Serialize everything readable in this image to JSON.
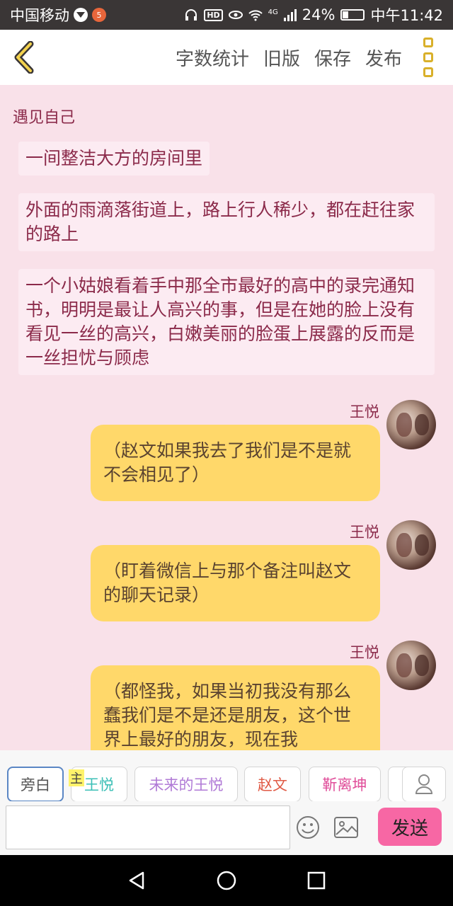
{
  "status_bar": {
    "carrier": "中国移动",
    "badge": "5",
    "network": "4G",
    "battery": "24%",
    "time": "中午11:42"
  },
  "topbar": {
    "actions": [
      "字数统计",
      "旧版",
      "保存",
      "发布"
    ]
  },
  "story": {
    "title": "遇见自己",
    "narrations": [
      "一间整洁大方的房间里",
      "外面的雨滴落街道上，路上行人稀少，都在赶往家的路上",
      "一个小姑娘看着手中那全市最好的高中的录完通知书，明明是最让人高兴的事，但是在她的脸上没有看见一丝的高兴，白嫩美丽的脸蛋上展露的反而是一丝担忧与顾虑"
    ],
    "messages": [
      {
        "speaker": "王悦",
        "text": "（赵文如果我去了我们是不是就不会相见了）"
      },
      {
        "speaker": "王悦",
        "text": "（盯着微信上与那个备注叫赵文的聊天记录）"
      },
      {
        "speaker": "王悦",
        "text": "（都怪我，如果当初我没有那么蠢我们是不是还是朋友，这个世界上最好的朋友，现在我"
      }
    ]
  },
  "roles": {
    "master_tag": "主",
    "chips": [
      {
        "label": "旁白",
        "color": "#555555"
      },
      {
        "label": "王悦",
        "color": "#3bbfb6"
      },
      {
        "label": "未来的王悦",
        "color": "#b07ad6"
      },
      {
        "label": "赵文",
        "color": "#e05a45"
      },
      {
        "label": "靳离坤",
        "color": "#e04e9a"
      }
    ]
  },
  "input": {
    "placeholder": "",
    "send_label": "发送"
  }
}
